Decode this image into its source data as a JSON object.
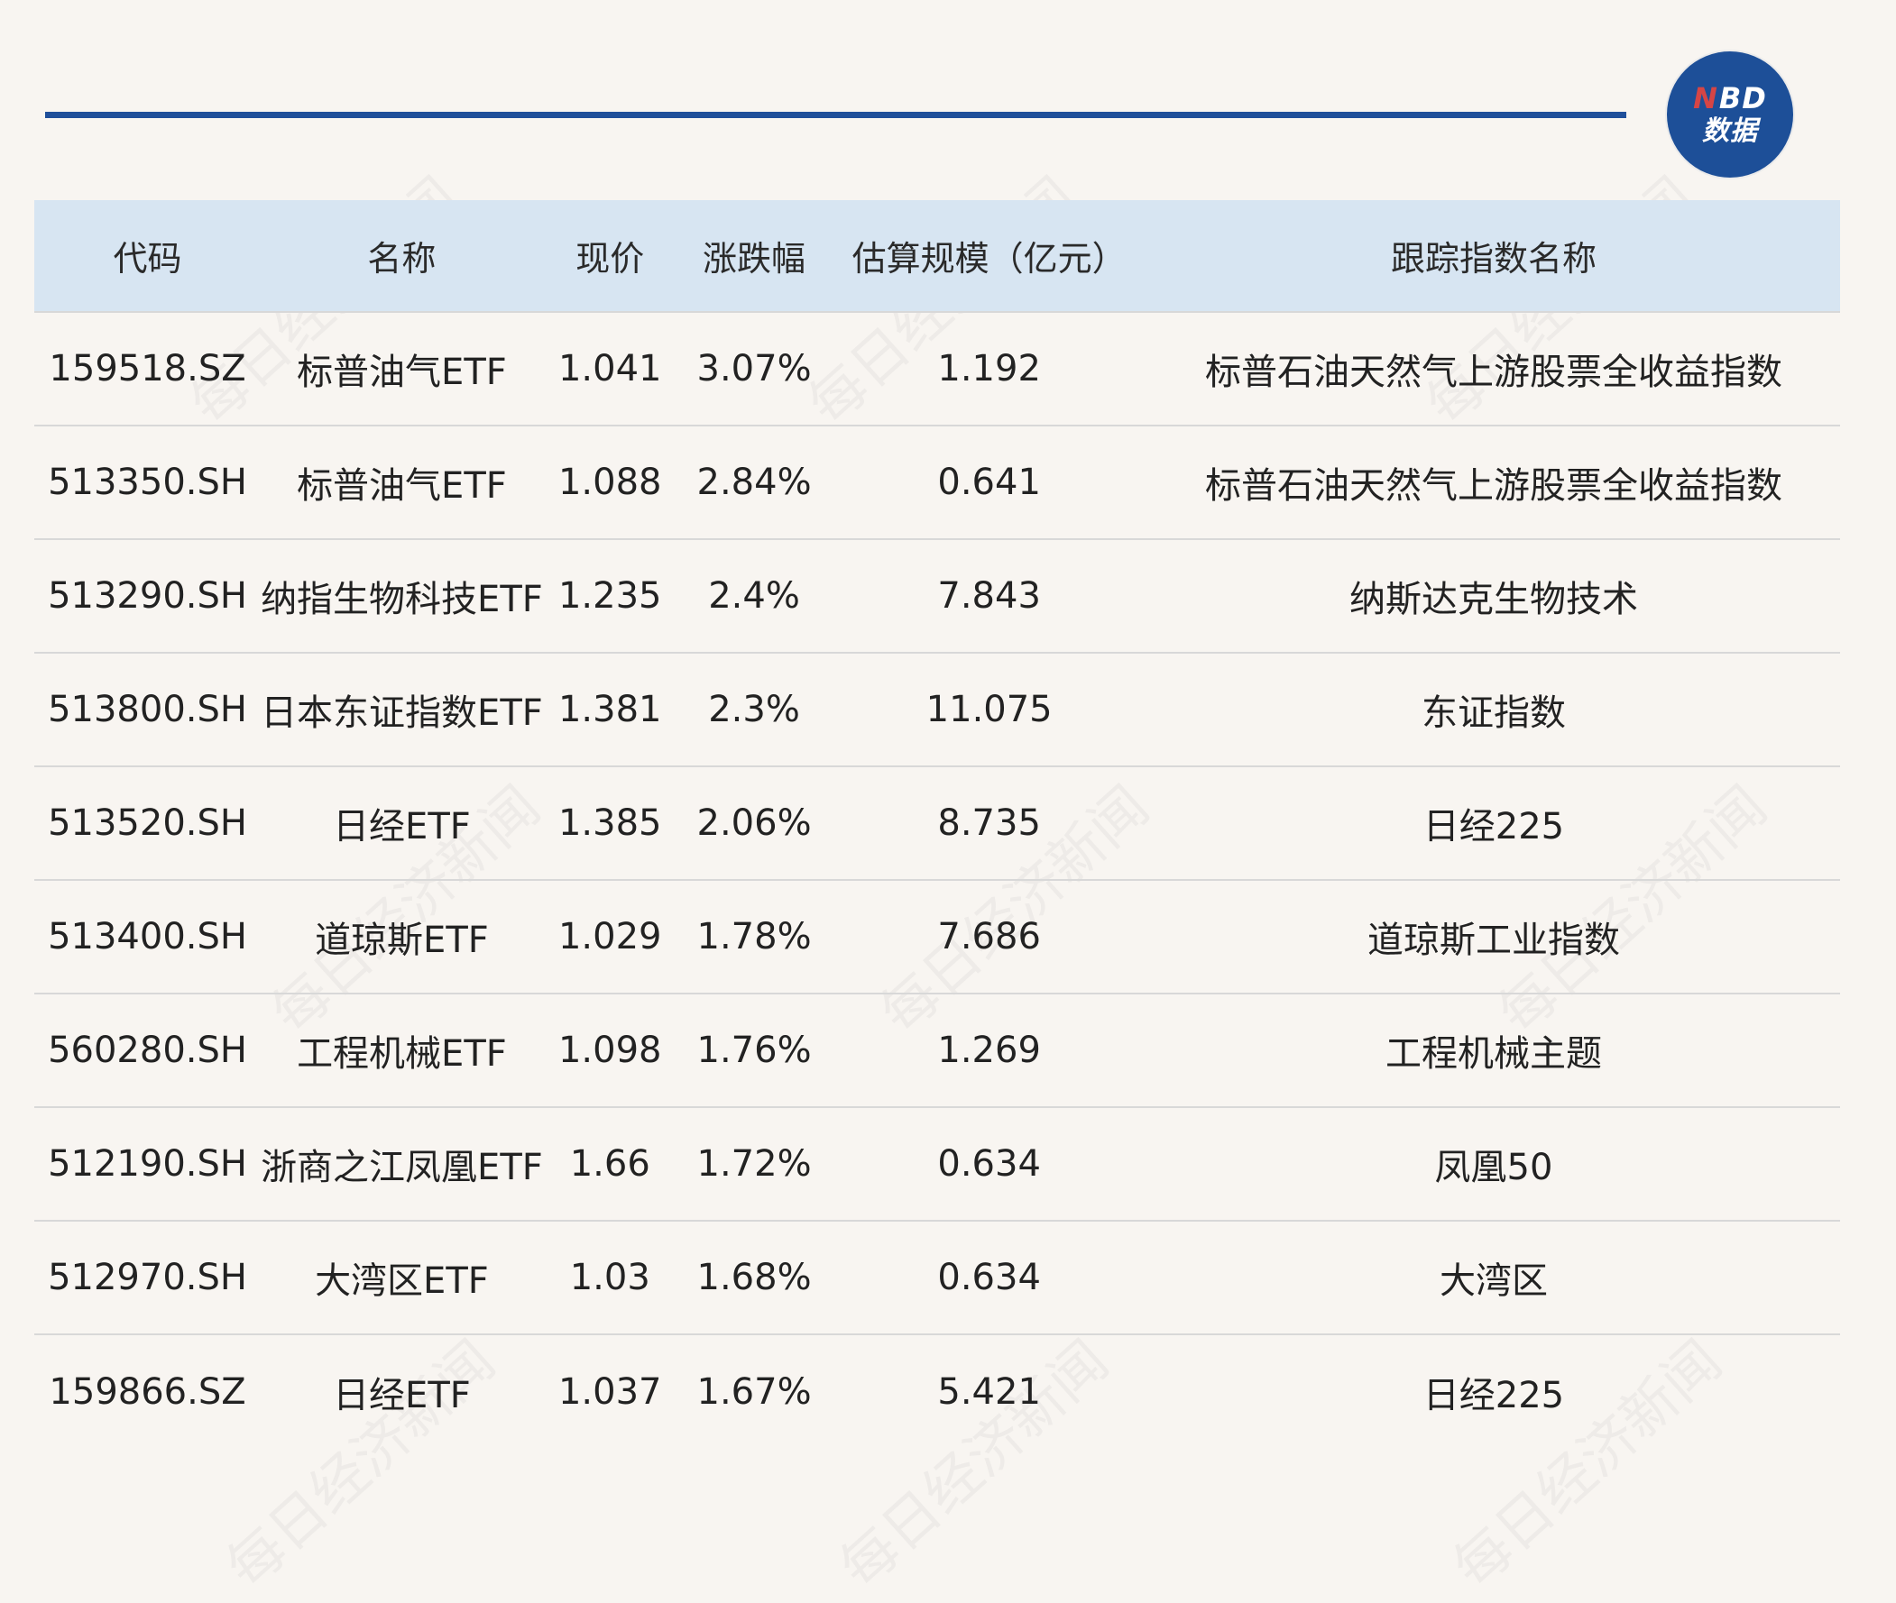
{
  "brand": {
    "logo_top_n": "N",
    "logo_top_bd": "BD",
    "logo_bottom": "数据"
  },
  "watermark": {
    "text": "每日经济新闻"
  },
  "table": {
    "headers": [
      "代码",
      "名称",
      "现价",
      "涨跌幅",
      "估算规模（亿元）",
      "跟踪指数名称"
    ],
    "rows": [
      [
        "159518.SZ",
        "标普油气ETF",
        "1.041",
        "3.07%",
        "1.192",
        "标普石油天然气上游股票全收益指数"
      ],
      [
        "513350.SH",
        "标普油气ETF",
        "1.088",
        "2.84%",
        "0.641",
        "标普石油天然气上游股票全收益指数"
      ],
      [
        "513290.SH",
        "纳指生物科技ETF",
        "1.235",
        "2.4%",
        "7.843",
        "纳斯达克生物技术"
      ],
      [
        "513800.SH",
        "日本东证指数ETF",
        "1.381",
        "2.3%",
        "11.075",
        "东证指数"
      ],
      [
        "513520.SH",
        "日经ETF",
        "1.385",
        "2.06%",
        "8.735",
        "日经225"
      ],
      [
        "513400.SH",
        "道琼斯ETF",
        "1.029",
        "1.78%",
        "7.686",
        "道琼斯工业指数"
      ],
      [
        "560280.SH",
        "工程机械ETF",
        "1.098",
        "1.76%",
        "1.269",
        "工程机械主题"
      ],
      [
        "512190.SH",
        "浙商之江凤凰ETF",
        "1.66",
        "1.72%",
        "0.634",
        "凤凰50"
      ],
      [
        "512970.SH",
        "大湾区ETF",
        "1.03",
        "1.68%",
        "0.634",
        "大湾区"
      ],
      [
        "159866.SZ",
        "日经ETF",
        "1.037",
        "1.67%",
        "5.421",
        "日经225"
      ]
    ]
  }
}
